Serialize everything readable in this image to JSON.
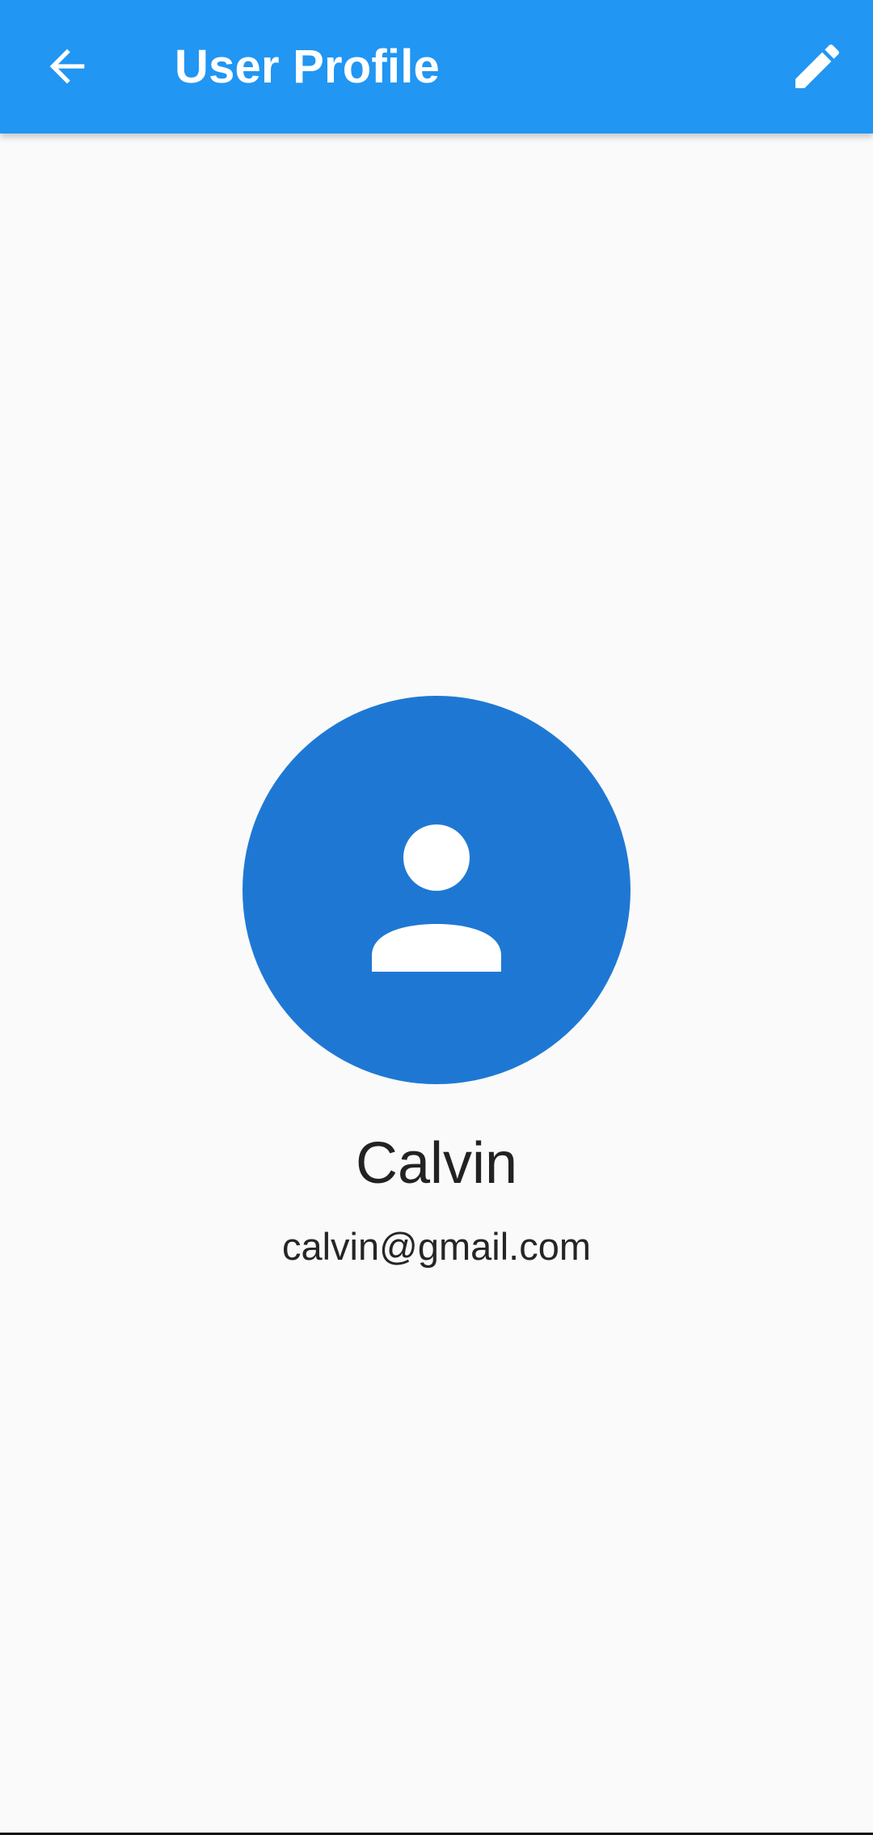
{
  "app_bar": {
    "title": "User Profile",
    "back_icon": "arrow-back-icon",
    "edit_icon": "pencil-icon",
    "background_color": "#2196f3",
    "foreground_color": "#ffffff"
  },
  "profile": {
    "avatar_icon": "person-icon",
    "avatar_color": "#1e78d3",
    "name": "Calvin",
    "email": "calvin@gmail.com"
  }
}
